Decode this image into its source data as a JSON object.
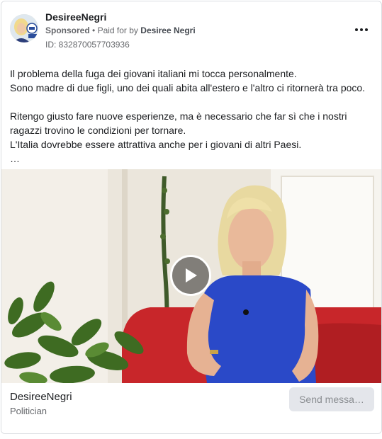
{
  "ad": {
    "page_name": "DesireeNegri",
    "sponsored_label": "Sponsored",
    "separator": "•",
    "paid_for_prefix": "Paid for by",
    "paid_for_name": "Desiree Negri",
    "ad_id": "ID: 832870057703936",
    "more_icon": "more-horizontal-icon"
  },
  "body": {
    "lines": [
      "Il problema della fuga dei giovani italiani mi tocca personalmente.",
      "Sono madre di due figli, uno dei quali abita all'estero e l'altro ci ritornerà tra poco.",
      "",
      "Ritengo giusto fare nuove esperienze, ma è necessario che far sì che i nostri",
      "ragazzi trovino le condizioni per tornare.",
      "L'Italia dovrebbe essere attrattiva anche per i giovani di altri Paesi.",
      "…"
    ]
  },
  "media": {
    "type": "video",
    "play_icon": "play-icon"
  },
  "footer": {
    "name": "DesireeNegri",
    "category": "Politician",
    "cta_label": "Send messa…"
  },
  "colors": {
    "text_primary": "#1c1e21",
    "text_secondary": "#65676b",
    "button_bg": "#e4e6eb",
    "button_text": "#8a8d91",
    "border": "#dadde1",
    "sofa_red": "#c8262a",
    "dress_blue": "#2a49c8"
  }
}
